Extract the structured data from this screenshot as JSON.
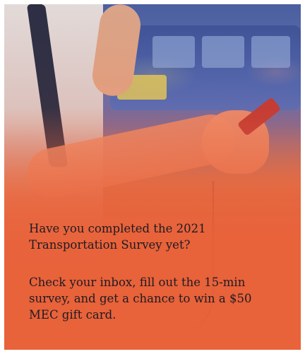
{
  "promo": {
    "headline": "Have you completed the 2021 Transportation Survey yet?",
    "body": "Check your inbox, fill out the 15-min survey, and get a chance to win a $50 MEC gift card."
  },
  "colors": {
    "overlay_orange": "#e8623a",
    "text_dark": "#1e1b22"
  }
}
